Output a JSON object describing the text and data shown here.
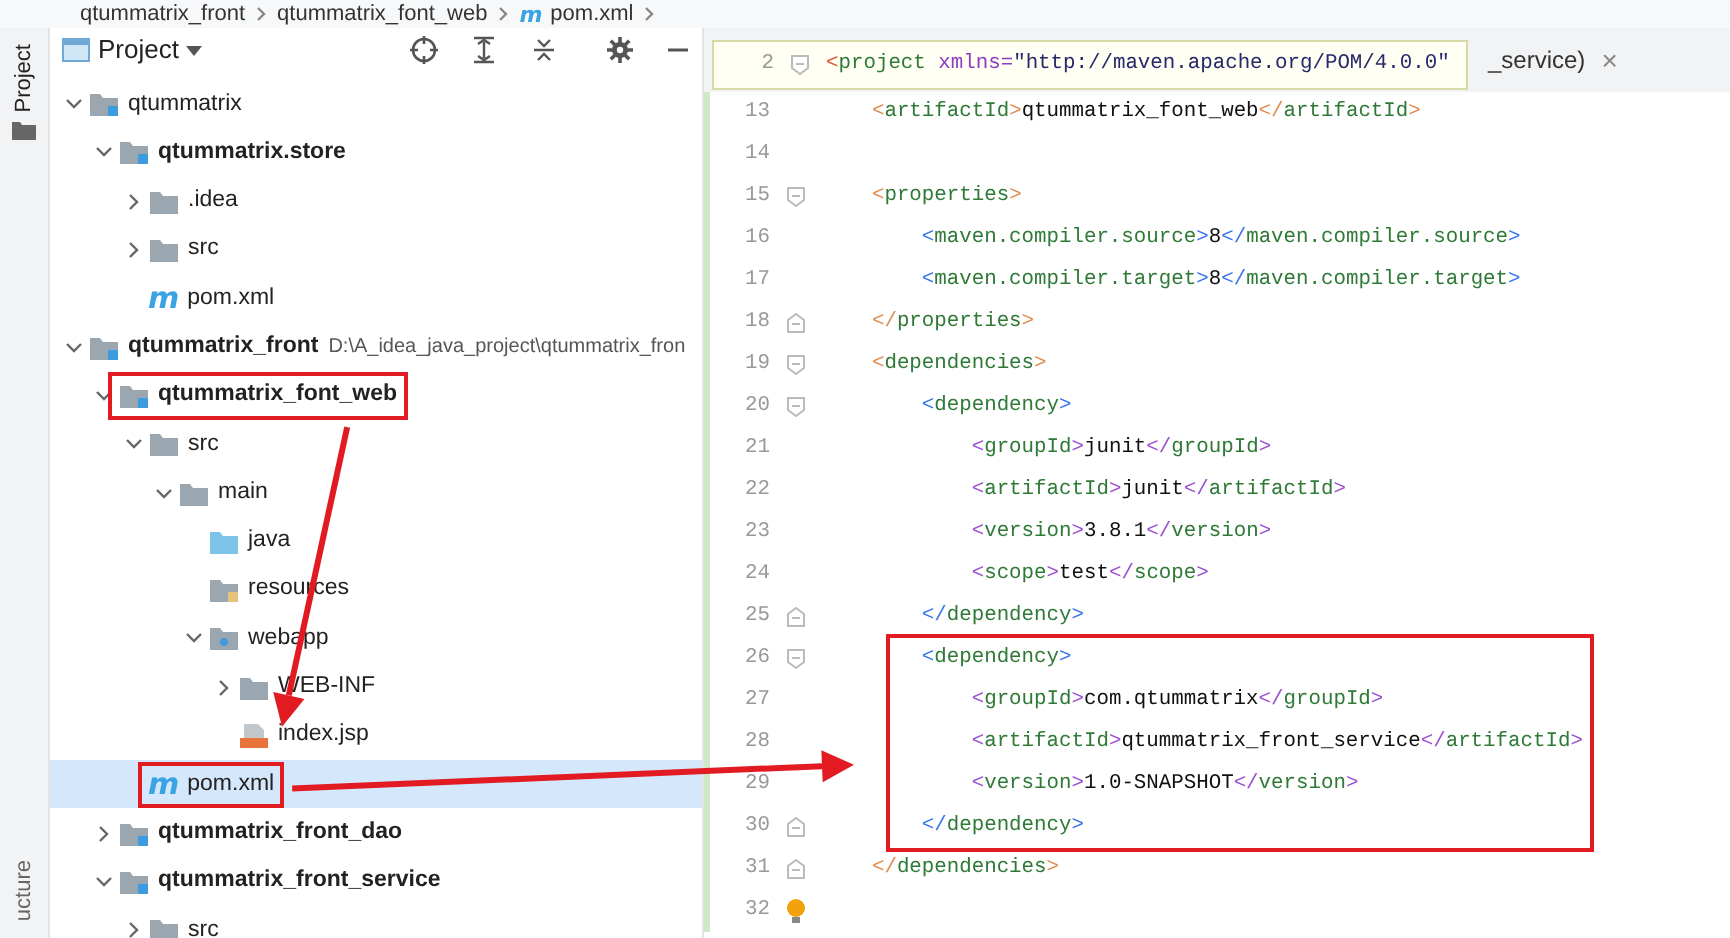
{
  "breadcrumb": [
    {
      "label": "qtummatrix_front",
      "kind": "module"
    },
    {
      "label": "qtummatrix_font_web",
      "kind": "module"
    },
    {
      "label": "pom.xml",
      "kind": "maven-file",
      "icon_text": "m"
    }
  ],
  "tool_strip": {
    "top_tab": "Project",
    "bottom_tab": "ucture"
  },
  "project_panel": {
    "title": "Project",
    "tree": [
      {
        "label": "qtummatrix",
        "kind": "module",
        "bold": false,
        "expanded": true,
        "selected": false,
        "boxed": false,
        "children": [
          {
            "label": "qtummatrix.store",
            "kind": "module",
            "bold": true,
            "expanded": true,
            "selected": false,
            "boxed": false,
            "children": [
              {
                "label": ".idea",
                "kind": "folder",
                "bold": false,
                "expanded": false,
                "selected": false,
                "boxed": false
              },
              {
                "label": "src",
                "kind": "folder",
                "bold": false,
                "expanded": false,
                "selected": false,
                "boxed": false
              },
              {
                "label": "pom.xml",
                "kind": "maven-file",
                "icon_text": "m",
                "bold": false,
                "selected": false,
                "boxed": false
              }
            ]
          }
        ]
      },
      {
        "label": "qtummatrix_front",
        "path": "D:\\A_idea_java_project\\qtummatrix_fron",
        "kind": "module",
        "bold": true,
        "expanded": true,
        "selected": false,
        "boxed": false,
        "children": [
          {
            "label": "qtummatrix_font_web",
            "kind": "module",
            "bold": true,
            "expanded": true,
            "selected": false,
            "boxed": true,
            "arrow_down": true,
            "children": [
              {
                "label": "src",
                "kind": "folder",
                "bold": false,
                "expanded": true,
                "selected": false,
                "boxed": false,
                "children": [
                  {
                    "label": "main",
                    "kind": "folder",
                    "bold": false,
                    "expanded": true,
                    "selected": false,
                    "boxed": false,
                    "children": [
                      {
                        "label": "java",
                        "kind": "source-folder",
                        "bold": false,
                        "selected": false,
                        "boxed": false
                      },
                      {
                        "label": "resources",
                        "kind": "resources-folder",
                        "bold": false,
                        "selected": false,
                        "boxed": false
                      },
                      {
                        "label": "webapp",
                        "kind": "web-folder",
                        "bold": false,
                        "expanded": true,
                        "selected": false,
                        "boxed": false,
                        "children": [
                          {
                            "label": "WEB-INF",
                            "kind": "folder",
                            "bold": false,
                            "expanded": false,
                            "selected": false,
                            "boxed": false
                          },
                          {
                            "label": "index.jsp",
                            "kind": "jsp-file",
                            "bold": false,
                            "selected": false,
                            "boxed": false,
                            "arrow_target": true
                          }
                        ]
                      }
                    ]
                  }
                ]
              },
              {
                "label": "pom.xml",
                "kind": "maven-file",
                "icon_text": "m",
                "bold": false,
                "selected": true,
                "boxed": true,
                "arrow_right": true
              }
            ]
          },
          {
            "label": "qtummatrix_front_dao",
            "kind": "module",
            "bold": true,
            "expanded": false,
            "selected": false,
            "boxed": false
          },
          {
            "label": "qtummatrix_front_service",
            "kind": "module",
            "bold": true,
            "expanded": true,
            "selected": false,
            "boxed": false,
            "children": [
              {
                "label": "src",
                "kind": "folder",
                "bold": false,
                "expanded": false,
                "selected": false,
                "boxed": false
              }
            ]
          }
        ]
      }
    ]
  },
  "editor": {
    "tab": {
      "label": "_service)",
      "close": "×"
    },
    "sticky_line": {
      "number": "2",
      "code": "<project xmlns=\"http://maven.apache.org/POM/4.0.0\"",
      "fold_start": true
    },
    "lines": [
      {
        "number": "13",
        "code": "    <artifactId>qtummatrix_font_web</artifactId>",
        "boxed": false
      },
      {
        "number": "14",
        "boxed": false
      },
      {
        "number": "15",
        "code": "    <properties>",
        "fold_start": true,
        "boxed": false
      },
      {
        "number": "16",
        "code": "        <maven.compiler.source>8</maven.compiler.source>",
        "boxed": false
      },
      {
        "number": "17",
        "code": "        <maven.compiler.target>8</maven.compiler.target>",
        "boxed": false
      },
      {
        "number": "18",
        "code": "    </properties>",
        "fold_end": true,
        "boxed": false
      },
      {
        "number": "19",
        "code": "    <dependencies>",
        "fold_start": true,
        "boxed": false
      },
      {
        "number": "20",
        "code": "        <dependency>",
        "fold_start": true,
        "boxed": false
      },
      {
        "number": "21",
        "code": "            <groupId>junit</groupId>",
        "boxed": false
      },
      {
        "number": "22",
        "code": "            <artifactId>junit</artifactId>",
        "boxed": false
      },
      {
        "number": "23",
        "code": "            <version>3.8.1</version>",
        "boxed": false
      },
      {
        "number": "24",
        "code": "            <scope>test</scope>",
        "boxed": false
      },
      {
        "number": "25",
        "code": "        </dependency>",
        "fold_end": true,
        "boxed": false
      },
      {
        "number": "26",
        "code": "        <dependency>",
        "fold_start": true,
        "boxed": true
      },
      {
        "number": "27",
        "code": "            <groupId>com.qtummatrix</groupId>",
        "boxed": true
      },
      {
        "number": "28",
        "code": "            <artifactId>qtummatrix_front_service</artifactId>",
        "boxed": true
      },
      {
        "number": "29",
        "code": "            <version>1.0-SNAPSHOT</version>",
        "boxed": true
      },
      {
        "number": "30",
        "code": "        </dependency>",
        "fold_end": true,
        "boxed": true
      },
      {
        "number": "31",
        "code": "    </dependencies>",
        "fold_end": true,
        "boxed": false
      },
      {
        "number": "32",
        "bulb": true,
        "boxed": false
      }
    ]
  }
}
